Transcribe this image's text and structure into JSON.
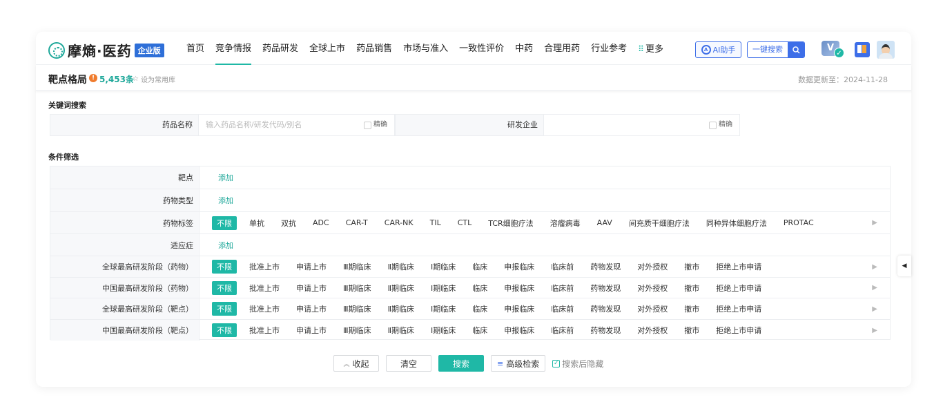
{
  "brand": {
    "name": "摩熵·医药",
    "badge": "企业版"
  },
  "menu": [
    {
      "label": "首页"
    },
    {
      "label": "竞争情报"
    },
    {
      "label": "药品研发"
    },
    {
      "label": "全球上市"
    },
    {
      "label": "药品销售"
    },
    {
      "label": "市场与准入"
    },
    {
      "label": "一致性评价"
    },
    {
      "label": "中药"
    },
    {
      "label": "合理用药"
    },
    {
      "label": "行业参考"
    },
    {
      "label": "更多"
    }
  ],
  "active_menu": "竞争情报",
  "header_tools": {
    "ai_label": "AI助手",
    "search_label": "一键搜索"
  },
  "page": {
    "title": "靶点格局",
    "count": "5,453条",
    "fav_label": "设为常用库",
    "update_text": "数据更新至：2024-11-28"
  },
  "keyword": {
    "section_title": "关键词搜索",
    "drug_label": "药品名称",
    "drug_placeholder": "输入药品名称/研发代码/别名",
    "exact_label": "精确",
    "company_label": "研发企业",
    "company_exact_label": "精确"
  },
  "filters": {
    "section_title": "条件筛选",
    "add_label": "添加",
    "all_label": "不限",
    "rows": [
      {
        "label": "靶点",
        "type": "add"
      },
      {
        "label": "药物类型",
        "type": "add"
      },
      {
        "label": "药物标签",
        "type": "options",
        "options": [
          "单抗",
          "双抗",
          "ADC",
          "CAR-T",
          "CAR-NK",
          "TIL",
          "CTL",
          "TCR细胞疗法",
          "溶瘤病毒",
          "AAV",
          "间充质干细胞疗法",
          "同种异体细胞疗法",
          "PROTAC"
        ]
      },
      {
        "label": "适应症",
        "type": "add"
      },
      {
        "label": "全球最高研发阶段（药物）",
        "type": "options",
        "options": [
          "批准上市",
          "申请上市",
          "Ⅲ期临床",
          "Ⅱ期临床",
          "Ⅰ期临床",
          "临床",
          "申报临床",
          "临床前",
          "药物发现",
          "对外授权",
          "撤市",
          "拒绝上市申请"
        ]
      },
      {
        "label": "中国最高研发阶段（药物）",
        "type": "options",
        "options": [
          "批准上市",
          "申请上市",
          "Ⅲ期临床",
          "Ⅱ期临床",
          "Ⅰ期临床",
          "临床",
          "申报临床",
          "临床前",
          "药物发现",
          "对外授权",
          "撤市",
          "拒绝上市申请"
        ]
      },
      {
        "label": "全球最高研发阶段（靶点）",
        "type": "options",
        "options": [
          "批准上市",
          "申请上市",
          "Ⅲ期临床",
          "Ⅱ期临床",
          "Ⅰ期临床",
          "临床",
          "申报临床",
          "临床前",
          "药物发现",
          "对外授权",
          "撤市",
          "拒绝上市申请"
        ]
      },
      {
        "label": "中国最高研发阶段（靶点）",
        "type": "options",
        "options": [
          "批准上市",
          "申请上市",
          "Ⅲ期临床",
          "Ⅱ期临床",
          "Ⅰ期临床",
          "临床",
          "申报临床",
          "临床前",
          "药物发现",
          "对外授权",
          "撤市",
          "拒绝上市申请"
        ]
      }
    ]
  },
  "actions": {
    "collapse": "收起",
    "clear": "清空",
    "search": "搜索",
    "advanced": "高级检索",
    "hide_after": "搜索后隐藏"
  },
  "colors": {
    "accent": "#1fb8a6",
    "blue": "#3d6ee8",
    "warn": "#f07c2e"
  }
}
